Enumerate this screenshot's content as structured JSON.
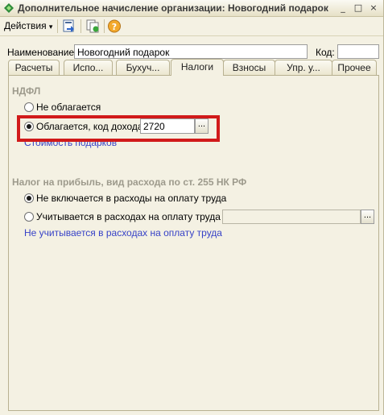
{
  "window": {
    "title": "Дополнительное начисление организации: Новогодний подарок",
    "controls": [
      "_",
      "□",
      "×"
    ]
  },
  "toolbar": {
    "actions_label": "Действия",
    "dropdown_glyph": "▾"
  },
  "form": {
    "name_label": "Наименование:",
    "name_value": "Новогодний подарок",
    "code_label": "Код:",
    "code_value": ""
  },
  "tabs": [
    {
      "label": "Расчеты"
    },
    {
      "label": "Испо..."
    },
    {
      "label": "Бухуч..."
    },
    {
      "label": "Налоги",
      "active": true
    },
    {
      "label": "Взносы"
    },
    {
      "label": "Упр. у..."
    },
    {
      "label": "Прочее"
    }
  ],
  "ndfl": {
    "title": "НДФЛ",
    "option_not_taxed": "Не облагается",
    "option_taxed": "Облагается, код дохода:",
    "income_code": "2720",
    "link": "Стоимость подарков"
  },
  "profit_tax": {
    "title": "Налог на прибыль, вид расхода по ст. 255 НК РФ",
    "option_not_included": "Не включается в расходы на оплату труда",
    "option_included": "Учитывается в расходах на оплату труда по:",
    "included_value": "",
    "link": "Не учитывается в расходах на оплату труда"
  },
  "ellipsis_glyph": "..."
}
